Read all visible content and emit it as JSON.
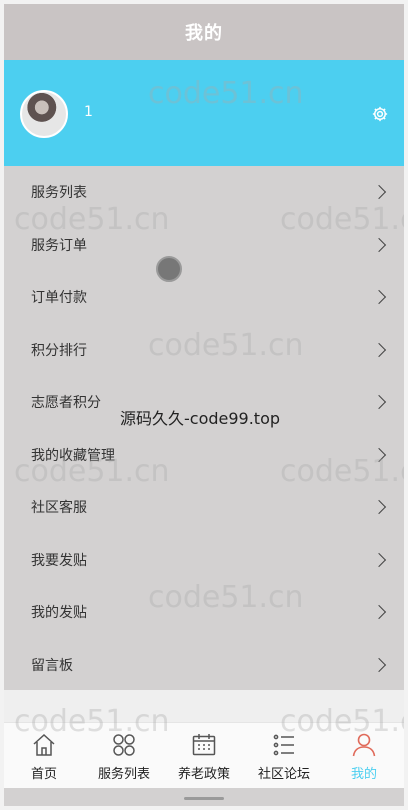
{
  "header": {
    "title": "我的"
  },
  "profile": {
    "user_id": "1",
    "avatar_icon": "user-avatar",
    "settings_icon": "gear-icon"
  },
  "menu": {
    "items": [
      {
        "label": "服务列表"
      },
      {
        "label": "服务订单"
      },
      {
        "label": "订单付款"
      },
      {
        "label": "积分排行"
      },
      {
        "label": "志愿者积分"
      },
      {
        "label": "我的收藏管理"
      },
      {
        "label": "社区客服"
      },
      {
        "label": "我要发贴"
      },
      {
        "label": "我的发贴"
      },
      {
        "label": "留言板"
      }
    ]
  },
  "tabbar": {
    "tabs": [
      {
        "label": "首页",
        "icon": "home-icon"
      },
      {
        "label": "服务列表",
        "icon": "grid-icon"
      },
      {
        "label": "养老政策",
        "icon": "calendar-icon"
      },
      {
        "label": "社区论坛",
        "icon": "list-icon"
      },
      {
        "label": "我的",
        "icon": "person-icon",
        "active": true
      }
    ]
  },
  "watermarks": {
    "repeat_text": "code51.cn",
    "center_text": "源码久久-code99.top"
  },
  "colors": {
    "accent": "#4ccff0",
    "title_bar": "#c9c4c4",
    "body": "#d3d1d1"
  }
}
